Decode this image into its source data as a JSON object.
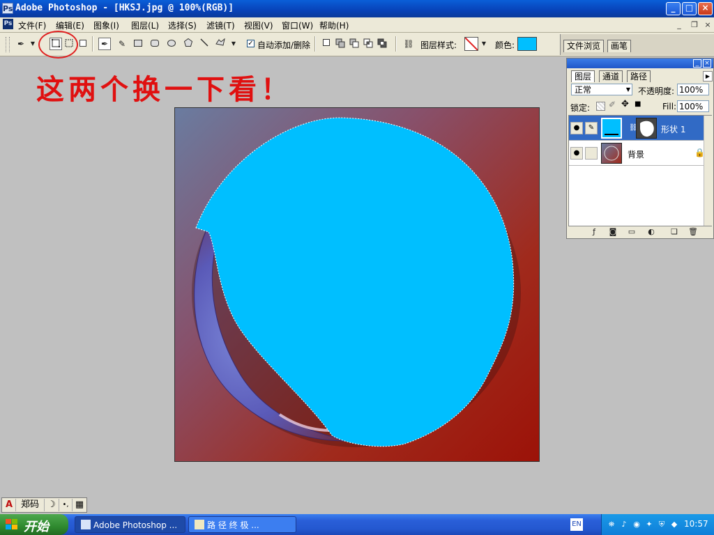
{
  "window": {
    "app_icon": "Ps",
    "title": "Adobe Photoshop - [HKSJ.jpg @ 100%(RGB)]",
    "controls": {
      "minimize": "_",
      "maximize": "□",
      "close": "×"
    }
  },
  "menubar": {
    "items": [
      "文件(F)",
      "编辑(E)",
      "图象(I)",
      "图层(L)",
      "选择(S)",
      "滤镜(T)",
      "视图(V)",
      "窗口(W)",
      "帮助(H)"
    ],
    "doc_controls": {
      "minimize": "_",
      "restore": "❐",
      "close": "×"
    }
  },
  "options": {
    "auto_add_delete_label": "自动添加/删除",
    "auto_add_delete_checked": "✓",
    "layer_style_label": "图层样式:",
    "color_label": "颜色:",
    "color_value": "#00bfff",
    "palette_well_tabs": [
      "文件浏览",
      "画笔"
    ]
  },
  "annotation": {
    "text": "这两个换一下看！",
    "color": "#e01010"
  },
  "canvas": {
    "shape_color": "#00bfff"
  },
  "layers_panel": {
    "tabs": [
      "图层",
      "通道",
      "路径"
    ],
    "blend_mode": "正常",
    "opacity_label": "不透明度:",
    "opacity_value": "100%",
    "lock_label": "锁定:",
    "fill_label": "Fill:",
    "fill_value": "100%",
    "layers": [
      {
        "name": "形状 1",
        "selected": true
      },
      {
        "name": "背景",
        "locked": true
      }
    ],
    "lock_glyph": "🔒"
  },
  "ime": {
    "mode_letter": "A",
    "name": "郑码",
    "moon": "☽",
    "punct": "•,",
    "keyboard": "▦"
  },
  "taskbar": {
    "start_label": "开始",
    "tasks": [
      "Adobe Photoshop ...",
      "路 径 终 极 ..."
    ],
    "lang": "EN",
    "clock": "10:57"
  }
}
